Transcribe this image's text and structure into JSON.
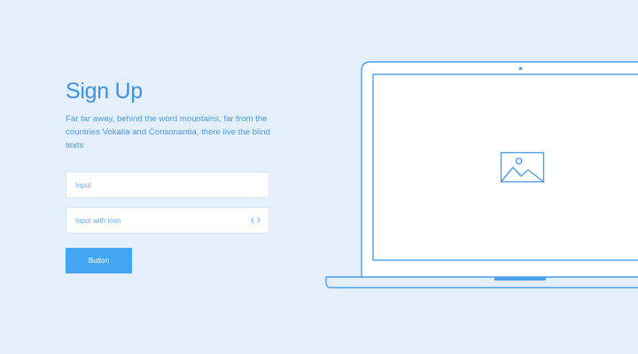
{
  "signup": {
    "title": "Sign Up",
    "description": "Far far away, behind the word mountains, far from the countries Vokalia and Consonantia, there live the blind texts"
  },
  "form": {
    "input_placeholder": "Input",
    "input_icon_placeholder": "Input with icon",
    "input_icon": "code-icon",
    "button_label": "Button"
  },
  "illustration": {
    "device": "laptop-icon",
    "screen_content": "image-placeholder-icon"
  },
  "colors": {
    "background": "#e3effb",
    "accent": "#3b93e4",
    "button": "#44a5f2",
    "outline": "#4a9de8",
    "field": "#ffffff"
  }
}
